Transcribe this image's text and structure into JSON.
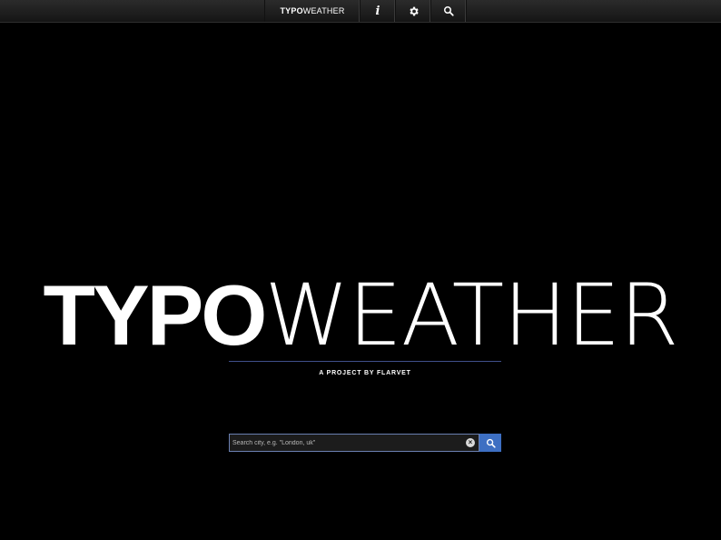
{
  "nav": {
    "brand_bold": "TYPO",
    "brand_light": "WEATHER",
    "info_glyph": "i",
    "info_icon": "info-icon",
    "settings_icon": "gear-icon",
    "search_icon": "search-icon"
  },
  "hero": {
    "title_bold": "TYPO",
    "title_light": "WEATHER",
    "tagline": "A PROJECT BY FLARVET"
  },
  "search": {
    "placeholder": "Search city, e.g. \"London, uk\"",
    "value": "",
    "clear_icon": "clear-icon",
    "button_icon": "search-icon"
  },
  "colors": {
    "background": "#000000",
    "accent": "#3d6fc2",
    "divider": "#3f4f8a"
  }
}
